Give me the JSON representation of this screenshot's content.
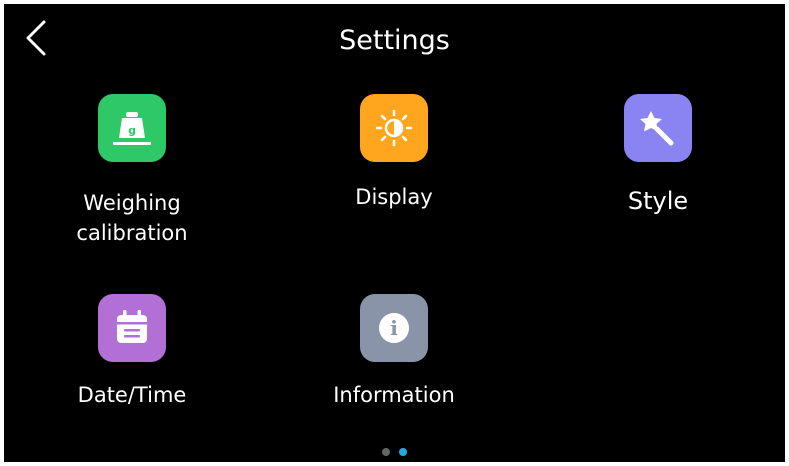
{
  "header": {
    "title": "Settings"
  },
  "apps": [
    {
      "id": "weighing",
      "label_line1": "Weighing",
      "label_line2": "calibration",
      "icon": "weight-icon",
      "color": "#2ec866",
      "icon_text": "g"
    },
    {
      "id": "display",
      "label": "Display",
      "icon": "brightness-icon",
      "color": "#ffa61e"
    },
    {
      "id": "style",
      "label": "Style",
      "icon": "magic-wand-icon",
      "color": "#8a84f2"
    },
    {
      "id": "datetime",
      "label": "Date/Time",
      "icon": "calendar-icon",
      "color": "#b26fd6"
    },
    {
      "id": "information",
      "label": "Information",
      "icon": "info-icon",
      "color": "#8a94a8",
      "icon_text": "i"
    }
  ],
  "pagination": {
    "pages": 2,
    "current": 2,
    "colors": {
      "inactive": "#666666",
      "active": "#24a9e1"
    }
  }
}
